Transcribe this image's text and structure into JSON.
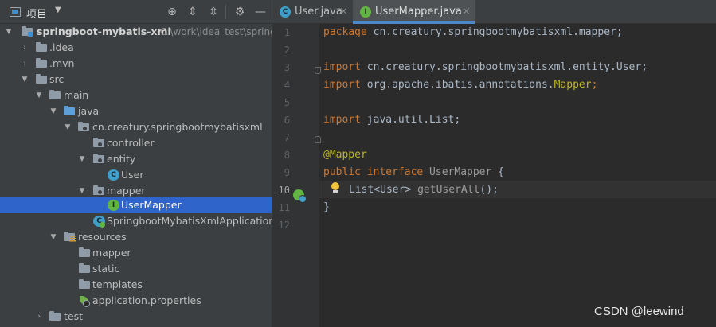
{
  "project_panel": {
    "title": "项目",
    "tree": [
      {
        "label": "springboot-mybatis-xml",
        "path": "C:\\work\\idea_test\\spring",
        "bold": true,
        "icon": "module-folder-icon",
        "arrow": "down",
        "indent": 0
      },
      {
        "label": ".idea",
        "icon": "folder-icon",
        "arrow": "right",
        "indent": 1
      },
      {
        "label": ".mvn",
        "icon": "folder-icon",
        "arrow": "right",
        "indent": 1
      },
      {
        "label": "src",
        "icon": "folder-icon",
        "arrow": "down",
        "indent": 1
      },
      {
        "label": "main",
        "icon": "folder-icon",
        "arrow": "down",
        "indent": 2
      },
      {
        "label": "java",
        "icon": "source-folder-icon",
        "arrow": "down",
        "indent": 3
      },
      {
        "label": "cn.creatury.springbootmybatisxml",
        "icon": "package-icon",
        "arrow": "down",
        "indent": 4
      },
      {
        "label": "controller",
        "icon": "package-icon",
        "arrow": "none",
        "indent": 5
      },
      {
        "label": "entity",
        "icon": "package-icon",
        "arrow": "down",
        "indent": 5
      },
      {
        "label": "User",
        "icon": "class-icon",
        "arrow": "none",
        "indent": 6
      },
      {
        "label": "mapper",
        "icon": "package-icon",
        "arrow": "down",
        "indent": 5
      },
      {
        "label": "UserMapper",
        "icon": "interface-icon",
        "arrow": "none",
        "indent": 6,
        "selected": true
      },
      {
        "label": "SpringbootMybatisXmlApplication",
        "icon": "spring-app-class-icon",
        "arrow": "none",
        "indent": 5
      },
      {
        "label": "resources",
        "icon": "resources-folder-icon",
        "arrow": "down",
        "indent": 3
      },
      {
        "label": "mapper",
        "icon": "folder-icon",
        "arrow": "none",
        "indent": 4
      },
      {
        "label": "static",
        "icon": "folder-icon",
        "arrow": "none",
        "indent": 4
      },
      {
        "label": "templates",
        "icon": "folder-icon",
        "arrow": "none",
        "indent": 4
      },
      {
        "label": "application.properties",
        "icon": "properties-file-icon",
        "arrow": "none",
        "indent": 4
      },
      {
        "label": "test",
        "icon": "folder-icon",
        "arrow": "right",
        "indent": 2
      }
    ]
  },
  "tabs": [
    {
      "label": "User.java",
      "icon": "class-icon",
      "active": false
    },
    {
      "label": "UserMapper.java",
      "icon": "interface-icon",
      "active": true
    }
  ],
  "editor": {
    "current_line": 10,
    "line_numbers": [
      "1",
      "2",
      "3",
      "4",
      "5",
      "6",
      "7",
      "8",
      "9",
      "10",
      "11",
      "12"
    ],
    "code": {
      "l1_kw": "package",
      "l1_rest": " cn.creatury.springbootmybatisxml.mapper;",
      "l3_kw": "import",
      "l3_rest": " cn.creatury.springbootmybatisxml.entity.User;",
      "l4_kw": "import",
      "l4_rest": " org.apache.ibatis.annotations.",
      "l4_ann": "Mapper",
      "l4_end": ";",
      "l6_kw": "import",
      "l6_rest": " java.util.List;",
      "l8_ann": "@Mapper",
      "l9_kw": "public interface",
      "l9_name": " UserMapper",
      "l9_end": " {",
      "l10_type": "List<User>",
      "l10_method": " getUserAll",
      "l10_end": "();",
      "l11": "}"
    }
  },
  "watermark": "CSDN @leewind",
  "colors": {
    "selection": "#2f65ca",
    "keyword": "#cc7832",
    "annotation": "#bbb529",
    "text": "#a9b7c6"
  }
}
